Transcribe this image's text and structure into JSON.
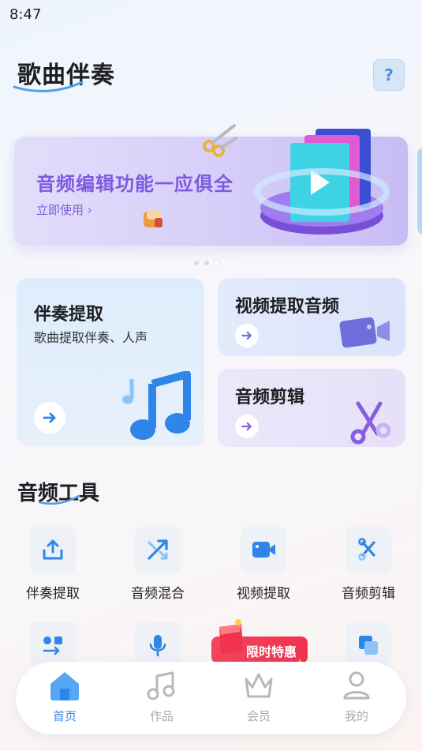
{
  "status_bar": {
    "time": "8:47"
  },
  "header": {
    "title": "歌曲伴奏",
    "help_label": "?"
  },
  "banner": {
    "title": "音频编辑功能一应俱全",
    "cta": "立即使用",
    "page_count": 3,
    "active_page": 3
  },
  "features": {
    "accompaniment": {
      "title": "伴奏提取",
      "subtitle": "歌曲提取伴奏、人声"
    },
    "video_extract": {
      "title": "视频提取音频"
    },
    "audio_edit": {
      "title": "音频剪辑"
    }
  },
  "tools": {
    "title": "音频工具",
    "items": [
      {
        "label": "伴奏提取",
        "icon": "upload-icon"
      },
      {
        "label": "音频混合",
        "icon": "shuffle-icon"
      },
      {
        "label": "视频提取",
        "icon": "video-camera-icon"
      },
      {
        "label": "音频剪辑",
        "icon": "scissors-icon"
      }
    ],
    "row2_icons": [
      "convert-icon",
      "microphone-icon",
      "tool-icon",
      "copy-icon"
    ]
  },
  "promo": {
    "label": "限时特惠"
  },
  "tabbar": {
    "items": [
      {
        "label": "首页",
        "icon": "home-icon"
      },
      {
        "label": "作品",
        "icon": "music-note-icon"
      },
      {
        "label": "会员",
        "icon": "crown-icon"
      },
      {
        "label": "我的",
        "icon": "person-icon"
      }
    ],
    "active_index": 0
  },
  "colors": {
    "accent_blue": "#3f86ee",
    "banner_purple": "#7d5ae0",
    "promo_red": "#f0334e"
  }
}
